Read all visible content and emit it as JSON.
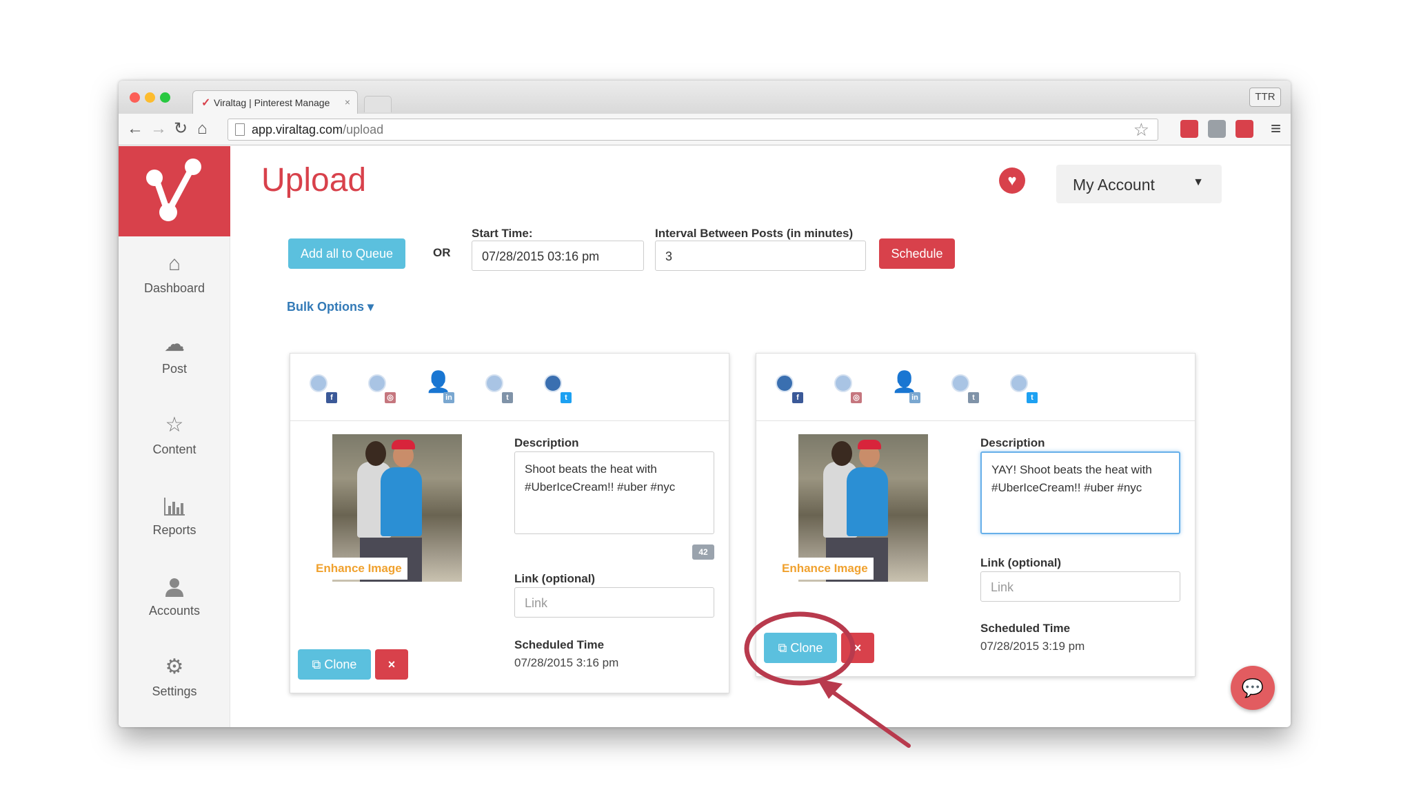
{
  "browser": {
    "tab_title": "Viraltag | Pinterest Manage",
    "tab_close": "×",
    "profile": "TTR",
    "url_host": "app.viraltag.com",
    "url_path": "/upload"
  },
  "sidebar": {
    "items": [
      {
        "label": "Dashboard",
        "icon": "home-icon"
      },
      {
        "label": "Post",
        "icon": "cloud-upload-icon"
      },
      {
        "label": "Content",
        "icon": "star-icon"
      },
      {
        "label": "Reports",
        "icon": "bar-chart-icon"
      },
      {
        "label": "Accounts",
        "icon": "user-icon"
      },
      {
        "label": "Settings",
        "icon": "gear-icon"
      }
    ]
  },
  "header": {
    "title": "Upload",
    "account_label": "My Account"
  },
  "controls": {
    "add_all_label": "Add all to Queue",
    "or_label": "OR",
    "start_time_label": "Start Time:",
    "start_time_value": "07/28/2015 03:16 pm",
    "interval_label": "Interval Between Posts (in minutes)",
    "interval_value": "3",
    "schedule_label": "Schedule",
    "bulk_options_label": "Bulk Options ▾"
  },
  "cards": [
    {
      "enhance_label": "Enhance Image",
      "description_label": "Description",
      "description_value": "Shoot beats the heat with #UberIceCream!! #uber #nyc",
      "char_count": "42",
      "link_label": "Link (optional)",
      "link_placeholder": "Link",
      "scheduled_label": "Scheduled Time",
      "scheduled_value": "07/28/2015 3:16 pm",
      "clone_label": "Clone",
      "delete_label": "×"
    },
    {
      "enhance_label": "Enhance Image",
      "description_label": "Description",
      "description_value": "YAY! Shoot beats the heat with #UberIceCream!! #uber #nyc",
      "link_label": "Link (optional)",
      "link_placeholder": "Link",
      "scheduled_label": "Scheduled Time",
      "scheduled_value": "07/28/2015 3:19 pm",
      "clone_label": "Clone",
      "delete_label": "×"
    }
  ],
  "colors": {
    "brand_red": "#d8414b",
    "button_blue": "#5bc0de",
    "link_blue": "#337ab7",
    "enhance_orange": "#f0a12e",
    "annotation_red": "#b83a4d"
  }
}
